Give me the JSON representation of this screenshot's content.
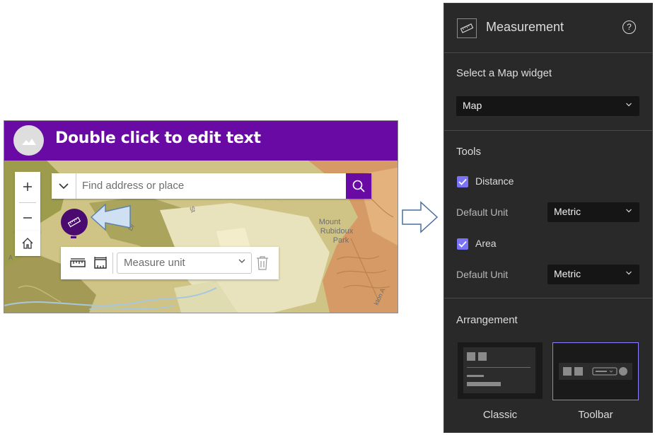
{
  "widget": {
    "header_title": "Double click to edit text",
    "search": {
      "placeholder": "Find address or place"
    },
    "measure_toolbar": {
      "unit_placeholder": "Measure unit"
    },
    "map_labels": [
      "Mount",
      "Rubidoux",
      "Park",
      "Dr",
      "St",
      "kton A",
      "A"
    ]
  },
  "panel": {
    "title": "Measurement",
    "help_label": "?",
    "map_widget_label": "Select a Map widget",
    "map_select_value": "Map",
    "tools_label": "Tools",
    "distance_label": "Distance",
    "distance_checked": true,
    "distance_unit_label": "Default Unit",
    "distance_unit_value": "Metric",
    "area_label": "Area",
    "area_checked": true,
    "area_unit_label": "Default Unit",
    "area_unit_value": "Metric",
    "arrangement_label": "Arrangement",
    "arrangement_options": [
      "Classic",
      "Toolbar"
    ],
    "arrangement_selected": "Toolbar"
  },
  "colors": {
    "header_purple": "#6a0aa4",
    "panel_bg": "#292929",
    "checkbox_accent": "#7a73f5",
    "selected_border": "#8a80ff"
  }
}
